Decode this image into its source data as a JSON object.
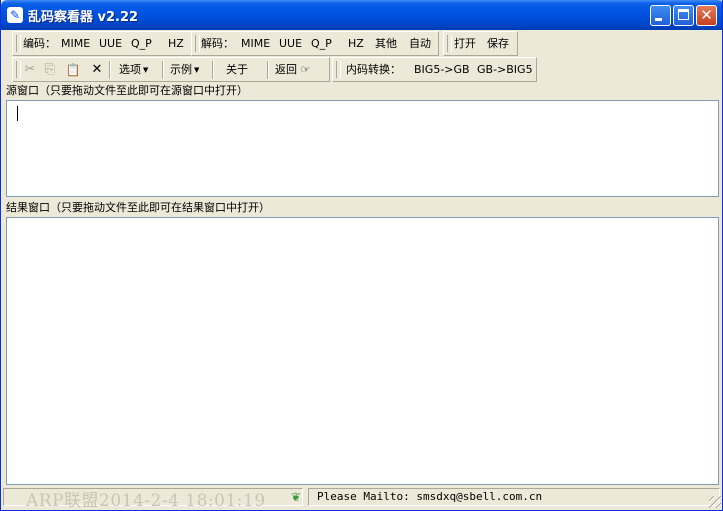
{
  "window": {
    "title": "乱码察看器 v2.22",
    "app_icon": "✎",
    "minimize_label": "",
    "maximize_label": "",
    "close_label": "✕"
  },
  "toolbar_encode": {
    "label": "编码：",
    "buttons": [
      "MIME",
      "UUE",
      "Q_P",
      "HZ"
    ]
  },
  "toolbar_decode": {
    "label": "解码：",
    "buttons": [
      "MIME",
      "UUE",
      "Q_P",
      "HZ",
      "其他",
      "自动"
    ]
  },
  "toolbar_file": {
    "open": "打开",
    "save": "保存"
  },
  "toolbar_edit": {
    "cut_icon": "✂",
    "copy_icon": "⎘",
    "paste_icon": "📋",
    "delete_icon": "✕",
    "options": "选项",
    "examples": "示例",
    "about": "关于",
    "back": "返回",
    "back_icon": "☞"
  },
  "toolbar_convert": {
    "label": "内码转换：",
    "big5_to_gb": "BIG5->GB",
    "gb_to_big5": "GB->BIG5"
  },
  "source_pane": {
    "label": "源窗口（只要拖动文件至此即可在源窗口中打开）",
    "content": ""
  },
  "result_pane": {
    "label": "结果窗口（只要拖动文件至此即可在结果窗口中打开）",
    "content": ""
  },
  "status": {
    "watermark": "ARP联盟2014-2-4 18:01:19",
    "mail": "Please Mailto: smsdxq@sbell.com.cn"
  },
  "colors": {
    "titlebar": "#0054e3",
    "face": "#ece9d8",
    "pane_border": "#7f9db9"
  }
}
